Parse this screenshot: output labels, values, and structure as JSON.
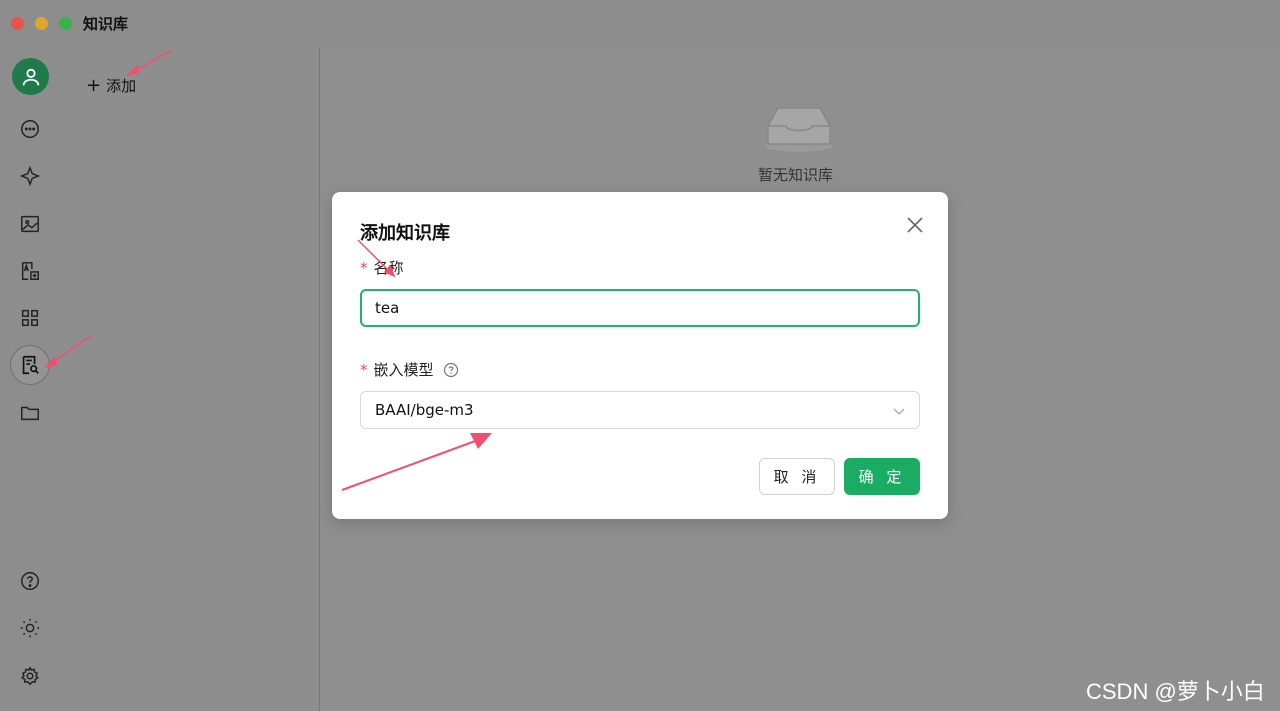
{
  "window": {
    "title": "知识库"
  },
  "sidebar": {
    "items": [
      {
        "icon": "user-avatar-icon"
      },
      {
        "icon": "chat-icon"
      },
      {
        "icon": "sparkle-icon"
      },
      {
        "icon": "image-icon"
      },
      {
        "icon": "translate-icon"
      },
      {
        "icon": "apps-grid-icon"
      },
      {
        "icon": "knowledge-base-icon",
        "active": true
      },
      {
        "icon": "folder-icon"
      },
      {
        "icon": "help-icon"
      },
      {
        "icon": "theme-sun-icon"
      },
      {
        "icon": "settings-gear-icon"
      }
    ]
  },
  "list_pane": {
    "add_label": "添加"
  },
  "main": {
    "empty_text": "暂无知识库"
  },
  "dialog": {
    "title": "添加知识库",
    "name_label": "名称",
    "name_value": "tea",
    "model_label": "嵌入模型",
    "model_value": "BAAI/bge-m3",
    "cancel_label": "取 消",
    "ok_label": "确 定"
  },
  "watermark": "CSDN @萝卜小白",
  "colors": {
    "accent": "#1aac62",
    "required": "#e84b4b",
    "annotation": "#f0506e"
  }
}
